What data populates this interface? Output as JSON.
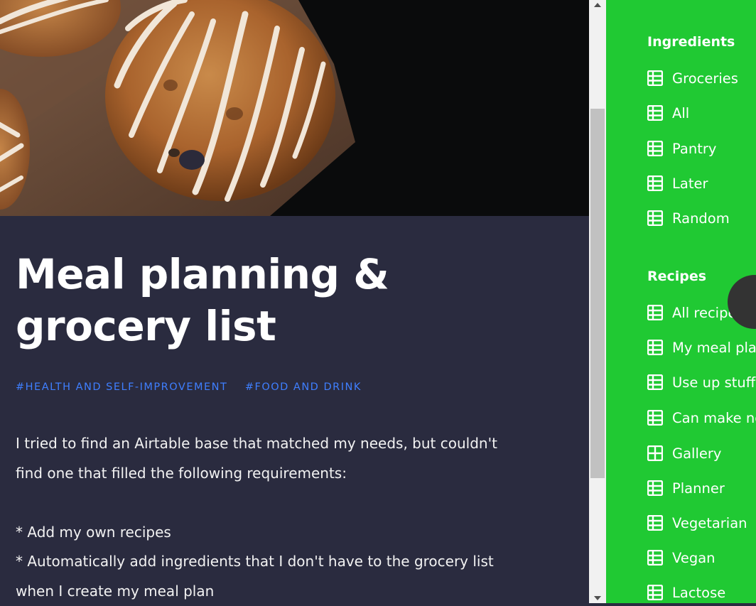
{
  "hero": {
    "image": "muffins-with-icing-photo"
  },
  "article": {
    "title": "Meal planning & grocery list",
    "tags": [
      "#HEALTH AND SELF-IMPROVEMENT",
      "#FOOD AND DRINK"
    ],
    "description": {
      "intro": "I tried to find an Airtable base that matched my needs, but couldn't find one that filled the following requirements:",
      "items": [
        "* Add my own recipes",
        "* Automatically add ingredients that I don't have to the grocery list when I create my meal plan"
      ]
    }
  },
  "sidebar": {
    "sections": [
      {
        "title": "Ingredients",
        "items": [
          {
            "label": "Groceries",
            "icon": "grid-view-icon"
          },
          {
            "label": "All",
            "icon": "grid-view-icon"
          },
          {
            "label": "Pantry",
            "icon": "grid-view-icon"
          },
          {
            "label": "Later",
            "icon": "grid-view-icon"
          },
          {
            "label": "Random",
            "icon": "grid-view-icon"
          }
        ]
      },
      {
        "title": "Recipes",
        "items": [
          {
            "label": "All recipes",
            "icon": "grid-view-icon"
          },
          {
            "label": "My meal plan",
            "icon": "grid-view-icon"
          },
          {
            "label": "Use up stuff",
            "icon": "grid-view-icon"
          },
          {
            "label": "Can make now",
            "icon": "grid-view-icon"
          },
          {
            "label": "Gallery",
            "icon": "gallery-view-icon"
          },
          {
            "label": "Planner",
            "icon": "grid-view-icon"
          },
          {
            "label": "Vegetarian",
            "icon": "grid-view-icon"
          },
          {
            "label": "Vegan",
            "icon": "grid-view-icon"
          },
          {
            "label": "Lactose",
            "icon": "grid-view-icon"
          }
        ]
      }
    ]
  },
  "colors": {
    "sidebar_bg": "#20c933",
    "content_bg": "#2a2b3f",
    "tag_color": "#3f7fff"
  }
}
